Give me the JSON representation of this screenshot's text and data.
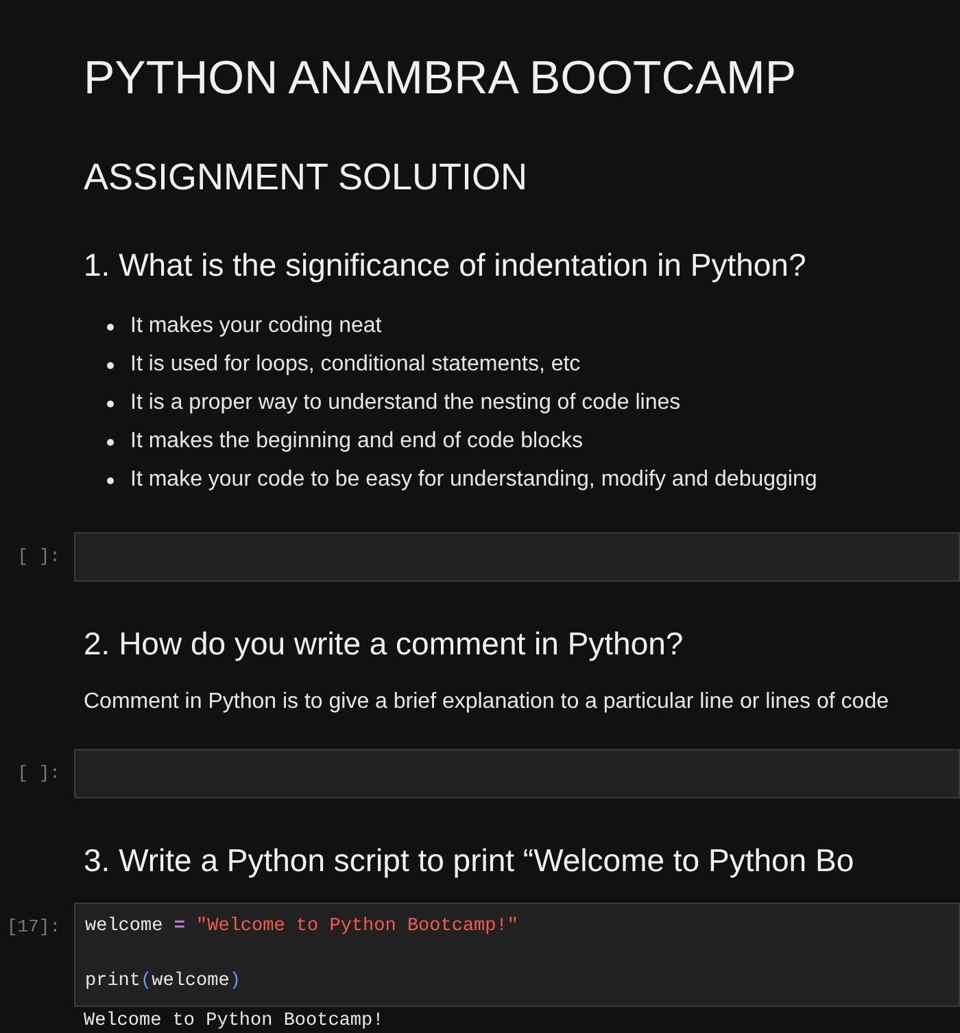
{
  "cells": [
    {
      "kind": "h1",
      "text": "PYTHON ANAMBRA BOOTCAMP"
    },
    {
      "kind": "h2",
      "text": "ASSIGNMENT SOLUTION"
    },
    {
      "kind": "h3",
      "text": "1. What is the significance of indentation in Python?"
    },
    {
      "kind": "bullets",
      "items": [
        "It makes your coding neat",
        "It is used for loops, conditional statements, etc",
        "It is a proper way to understand the nesting of code lines",
        "It makes the beginning and end of code blocks",
        "It make your code to be easy for understanding, modify and debugging"
      ]
    },
    {
      "kind": "code",
      "prompt": "[ ]:"
    },
    {
      "kind": "h3",
      "text": "2. How do you write a comment in Python?"
    },
    {
      "kind": "para",
      "text": "Comment in Python is to give a brief explanation to a particular line or lines of code"
    },
    {
      "kind": "code",
      "prompt": "[ ]:"
    },
    {
      "kind": "h3",
      "text": "3. Write a Python script to print “Welcome to Python Bo"
    },
    {
      "kind": "code",
      "prompt": "[17]:",
      "lines": [
        {
          "kind": "code",
          "tokens": [
            {
              "kind": "name",
              "text": "welcome"
            },
            {
              "kind": "op",
              "text": "="
            },
            {
              "kind": "string",
              "text": "\"Welcome to Python Bootcamp!\""
            }
          ]
        },
        {
          "kind": "blank"
        },
        {
          "kind": "code",
          "tokens": [
            {
              "kind": "name",
              "text": "print"
            },
            {
              "kind": "paren",
              "text": "("
            },
            {
              "kind": "name",
              "text": "welcome"
            },
            {
              "kind": "paren",
              "text": ")"
            }
          ]
        }
      ]
    },
    {
      "kind": "output",
      "text": "Welcome to Python Bootcamp!"
    }
  ]
}
